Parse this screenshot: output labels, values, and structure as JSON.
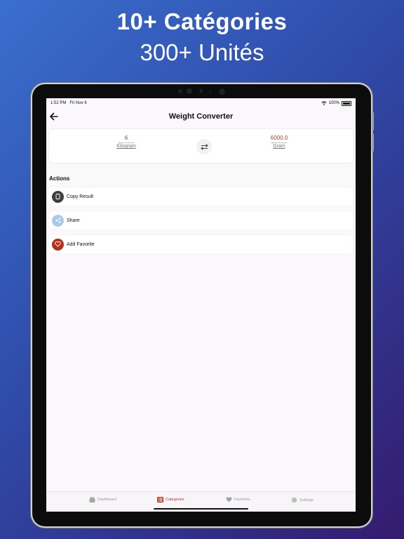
{
  "promo": {
    "title": "10+ Catégories",
    "subtitle": "300+ Unités"
  },
  "status_bar": {
    "time": "1:52 PM",
    "date": "Fri Nov 6",
    "battery": "100%"
  },
  "header": {
    "title": "Weight Converter",
    "back_icon": "arrow-left-icon"
  },
  "converter": {
    "from": {
      "value": "6",
      "unit": "Kilogram"
    },
    "to": {
      "value": "6000.0",
      "unit": "Gram"
    },
    "swap_icon": "swap-arrows-icon"
  },
  "actions": {
    "label": "Actions",
    "items": [
      {
        "label": "Copy Result",
        "icon": "copy-icon",
        "color": "#3f3f3f"
      },
      {
        "label": "Share",
        "icon": "share-icon",
        "color": "#a9cbe8"
      },
      {
        "label": "Add Favorite",
        "icon": "heart-icon",
        "color": "#b5301f"
      }
    ]
  },
  "tab_bar": {
    "items": [
      {
        "label": "Dashboard",
        "icon": "dashboard-icon",
        "active": false
      },
      {
        "label": "Categories",
        "icon": "list-icon",
        "active": true
      },
      {
        "label": "Favorites",
        "icon": "heart-icon",
        "active": false
      },
      {
        "label": "Settings",
        "icon": "gear-icon",
        "active": false
      }
    ]
  },
  "colors": {
    "accent": "#c0392b",
    "background": "#fbf8fb"
  }
}
